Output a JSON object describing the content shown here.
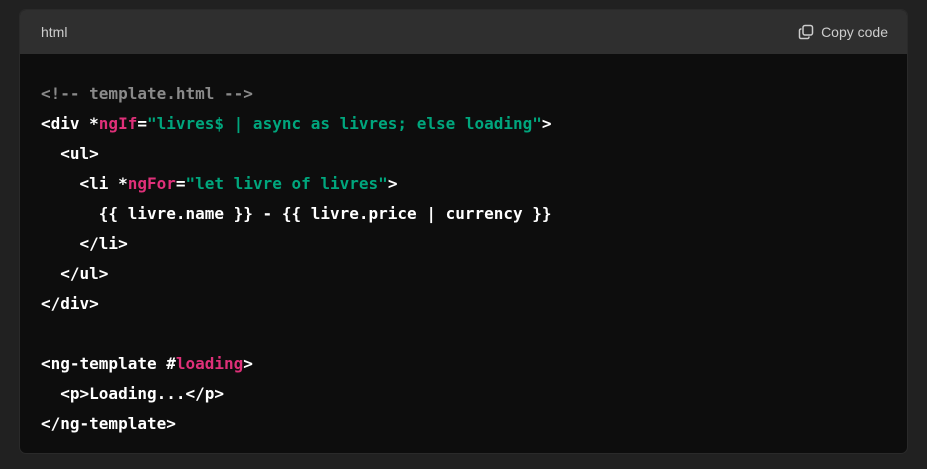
{
  "header": {
    "language": "html",
    "copy_label": "Copy code",
    "copy_icon": "copy-icon"
  },
  "colors": {
    "background": "#212121",
    "code_bg": "#0d0d0d",
    "header_bg": "#2f2f2f",
    "comment": "#8a8a8a",
    "attribute": "#df3079",
    "string": "#00a67d",
    "plain": "#ffffff"
  },
  "code_lines": [
    [
      {
        "t": "<!-- template.html -->",
        "k": "comment"
      }
    ],
    [
      {
        "t": "<div *",
        "k": "plain"
      },
      {
        "t": "ngIf",
        "k": "attr"
      },
      {
        "t": "=",
        "k": "plain"
      },
      {
        "t": "\"livres$ | async as livres; else loading\"",
        "k": "str"
      },
      {
        "t": ">",
        "k": "plain"
      }
    ],
    [
      {
        "t": "  <ul>",
        "k": "plain"
      }
    ],
    [
      {
        "t": "    <li *",
        "k": "plain"
      },
      {
        "t": "ngFor",
        "k": "attr"
      },
      {
        "t": "=",
        "k": "plain"
      },
      {
        "t": "\"let livre of livres\"",
        "k": "str"
      },
      {
        "t": ">",
        "k": "plain"
      }
    ],
    [
      {
        "t": "      {{ livre.name }} - {{ livre.price | currency }}",
        "k": "plain"
      }
    ],
    [
      {
        "t": "    </li>",
        "k": "plain"
      }
    ],
    [
      {
        "t": "  </ul>",
        "k": "plain"
      }
    ],
    [
      {
        "t": "</div>",
        "k": "plain"
      }
    ],
    [
      {
        "t": "",
        "k": "plain"
      }
    ],
    [
      {
        "t": "<ng-template #",
        "k": "plain"
      },
      {
        "t": "loading",
        "k": "attr"
      },
      {
        "t": ">",
        "k": "plain"
      }
    ],
    [
      {
        "t": "  <p>Loading...</p>",
        "k": "plain"
      }
    ],
    [
      {
        "t": "</ng-template>",
        "k": "plain"
      }
    ]
  ]
}
